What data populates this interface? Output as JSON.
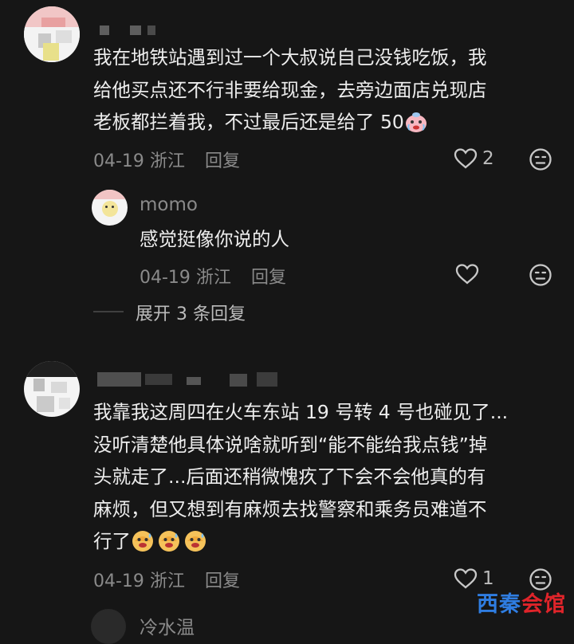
{
  "comments": [
    {
      "username": "",
      "text_lines": [
        "我在地铁站遇到过一个大叔说自己没钱吃饭，我",
        "给他买点还不行非要给现金，去旁边面店兑现店",
        "老板都拦着我，不过最后还是给了 50"
      ],
      "date": "04-19",
      "location": "浙江",
      "reply_label": "回复",
      "like_count": "2",
      "like_icon": "heart-outline-icon",
      "dislike_icon": "meh-face-icon",
      "emoji": "crying-face-emoji"
    },
    {
      "username": "momo",
      "text_lines": [
        "感觉挺像你说的人"
      ],
      "date": "04-19",
      "location": "浙江",
      "reply_label": "回复",
      "like_count": "",
      "like_icon": "heart-outline-icon",
      "dislike_icon": "meh-face-icon"
    },
    {
      "username": "",
      "text_lines": [
        "我靠我这周四在火车东站 19 号转 4 号也碰见了...",
        "没听清楚他具体说啥就听到“能不能给我点钱”掉",
        "头就走了...后面还稍微愧疚了下会不会他真的有",
        "麻烦，但又想到有麻烦去找警察和乘务员难道不",
        "行了"
      ],
      "date": "04-19",
      "location": "浙江",
      "reply_label": "回复",
      "like_count": "1",
      "like_icon": "heart-outline-icon",
      "dislike_icon": "meh-face-icon",
      "emoji": "sweating-face-emoji"
    }
  ],
  "expand_replies": "展开 3 条回复",
  "next_username_partial": "冷水温",
  "watermark": {
    "part1": "西秦",
    "part2": "会馆"
  },
  "colors": {
    "background": "#161616",
    "text": "#ededed",
    "meta": "#8a8a8a",
    "watermark_blue": "#2f7de1",
    "watermark_red": "#e0242a"
  }
}
